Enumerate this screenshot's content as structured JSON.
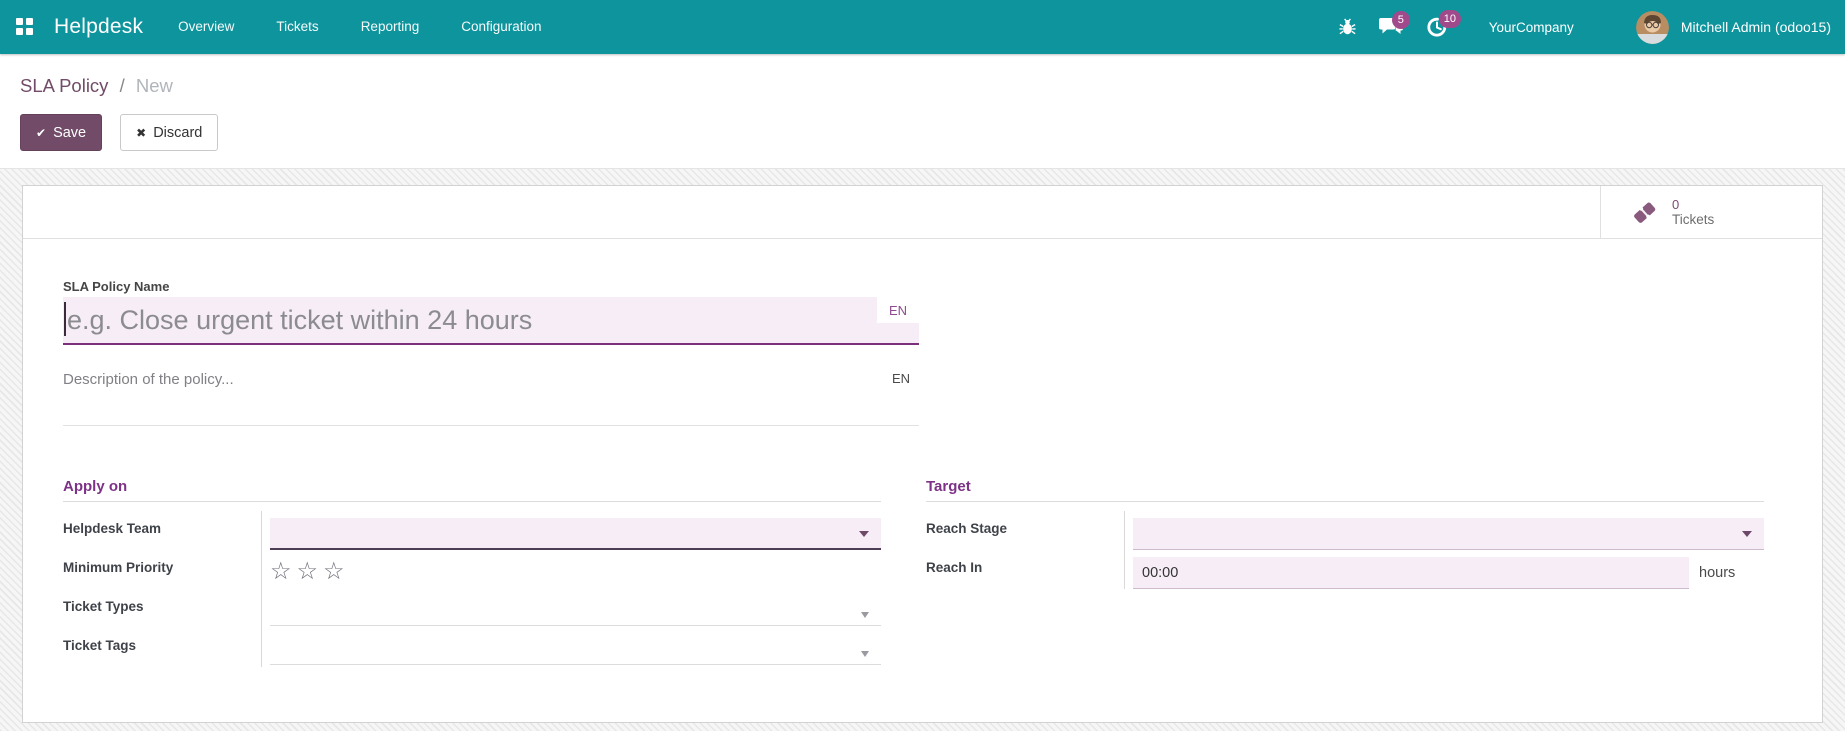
{
  "navbar": {
    "app_name": "Helpdesk",
    "menu": [
      "Overview",
      "Tickets",
      "Reporting",
      "Configuration"
    ],
    "messages_badge": "5",
    "activities_badge": "10",
    "company": "YourCompany",
    "user": "Mitchell Admin (odoo15)"
  },
  "breadcrumb": {
    "parent": "SLA Policy",
    "separator": "/",
    "current": "New"
  },
  "actions": {
    "save_label": "Save",
    "discard_label": "Discard"
  },
  "button_box": {
    "tickets_count": "0",
    "tickets_label": "Tickets"
  },
  "form": {
    "name": {
      "label": "SLA Policy Name",
      "value": "",
      "placeholder": "e.g. Close urgent ticket within 24 hours",
      "lang_badge": "EN"
    },
    "description": {
      "value": "",
      "placeholder": "Description of the policy...",
      "lang_badge": "EN"
    },
    "apply_on": {
      "title": "Apply on",
      "helpdesk_team": {
        "label": "Helpdesk Team",
        "value": ""
      },
      "minimum_priority": {
        "label": "Minimum Priority",
        "stars_total": 3,
        "stars_selected": 0
      },
      "ticket_types": {
        "label": "Ticket Types",
        "value": ""
      },
      "ticket_tags": {
        "label": "Ticket Tags",
        "value": ""
      }
    },
    "target": {
      "title": "Target",
      "reach_stage": {
        "label": "Reach Stage",
        "value": ""
      },
      "reach_in": {
        "label": "Reach In",
        "value": "00:00",
        "suffix": "hours"
      }
    }
  },
  "icons": {
    "check": "✔",
    "discard": "✖",
    "star": "☆",
    "names": [
      "apps-grid-icon",
      "bug-icon",
      "messages-icon",
      "activity-clock-icon",
      "ticket-icon",
      "dropdown-caret-icon"
    ]
  },
  "colors": {
    "navbar_teal": "#0e949d",
    "brand_purple": "#714B67",
    "heading_purple": "#7d3287",
    "badge_magenta": "#a04a8c",
    "required_field_lavender": "#f6edf7",
    "focused_underline": "#7a3179"
  }
}
